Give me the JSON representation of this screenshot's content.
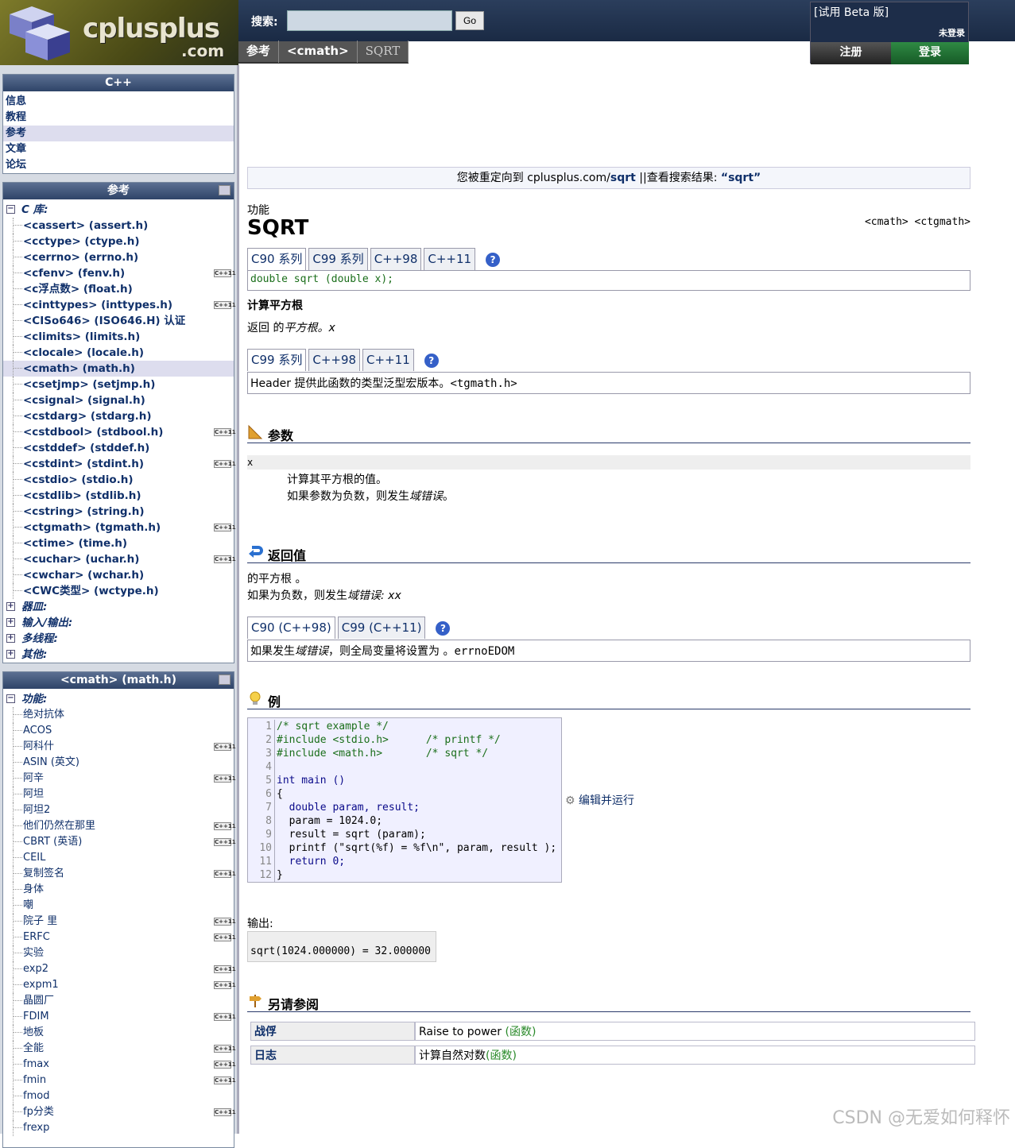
{
  "header": {
    "logo_main": "cplusplus",
    "logo_sub": ".com",
    "search_label": "搜索:",
    "search_value": "",
    "go_label": "Go",
    "breadcrumb": [
      "参考",
      "<cmath>",
      "SQRT"
    ],
    "beta": "[试用 Beta 版]",
    "not_logged": "未登录",
    "register": "注册",
    "login": "登录"
  },
  "sidebar": {
    "cpp_title": "C++",
    "cpp_items": [
      "信息",
      "教程",
      "参考",
      "文章",
      "论坛"
    ],
    "ref_title": "参考",
    "ref_items": [
      {
        "label": "C 库:",
        "cat": true,
        "sign": "⊟"
      },
      {
        "label": "<cassert>  (assert.h)"
      },
      {
        "label": "<cctype>  (ctype.h)"
      },
      {
        "label": "<cerrno>  (errno.h)"
      },
      {
        "label": "<cfenv>  (fenv.h)",
        "badge": "C++11"
      },
      {
        "label": "<c浮点数>  (float.h)"
      },
      {
        "label": "<cinttypes>  (inttypes.h)",
        "badge": "C++11"
      },
      {
        "label": "<CISo646>  (ISO646.H)  认证"
      },
      {
        "label": "<climits>  (limits.h)"
      },
      {
        "label": "<clocale>  (locale.h)"
      },
      {
        "label": "<cmath>  (math.h)",
        "sel": true
      },
      {
        "label": "<csetjmp>  (setjmp.h)"
      },
      {
        "label": "<csignal>  (signal.h)"
      },
      {
        "label": "<cstdarg>  (stdarg.h)"
      },
      {
        "label": "<cstdbool>  (stdbool.h)",
        "badge": "C++11"
      },
      {
        "label": "<cstddef>  (stddef.h)"
      },
      {
        "label": "<cstdint>  (stdint.h)",
        "badge": "C++11"
      },
      {
        "label": "<cstdio>  (stdio.h)"
      },
      {
        "label": "<cstdlib>  (stdlib.h)"
      },
      {
        "label": "<cstring>  (string.h)"
      },
      {
        "label": "<ctgmath>  (tgmath.h)",
        "badge": "C++11"
      },
      {
        "label": "<ctime>  (time.h)"
      },
      {
        "label": "<cuchar>  (uchar.h)",
        "badge": "C++11"
      },
      {
        "label": "<cwchar>  (wchar.h)"
      },
      {
        "label": "<CWC类型>  (wctype.h)"
      },
      {
        "label": "器皿:",
        "cat": true,
        "sign": "⊞"
      },
      {
        "label": "输入/输出:",
        "cat": true,
        "sign": "⊞"
      },
      {
        "label": "多线程:",
        "cat": true,
        "sign": "⊞"
      },
      {
        "label": "其他:",
        "cat": true,
        "sign": "⊞"
      }
    ],
    "math_title": "<cmath>  (math.h)",
    "math_cat": "功能:",
    "math_items": [
      {
        "label": "绝对抗体"
      },
      {
        "label": "ACOS"
      },
      {
        "label": "阿科什",
        "badge": "C++11"
      },
      {
        "label": "ASIN  (英文)"
      },
      {
        "label": "阿辛",
        "badge": "C++11"
      },
      {
        "label": "阿坦"
      },
      {
        "label": "阿坦2"
      },
      {
        "label": "他们仍然在那里",
        "badge": "C++11"
      },
      {
        "label": "CBRT  (英语)",
        "badge": "C++11"
      },
      {
        "label": "CEIL"
      },
      {
        "label": "复制签名",
        "badge": "C++11"
      },
      {
        "label": "身体"
      },
      {
        "label": "嘲"
      },
      {
        "label": "院子 里",
        "badge": "C++11"
      },
      {
        "label": "ERFC",
        "badge": "C++11"
      },
      {
        "label": "实验"
      },
      {
        "label": "exp2",
        "badge": "C++11"
      },
      {
        "label": "expm1",
        "badge": "C++11"
      },
      {
        "label": "晶圆厂"
      },
      {
        "label": "FDIM",
        "badge": "C++11"
      },
      {
        "label": "地板"
      },
      {
        "label": "全能",
        "badge": "C++11"
      },
      {
        "label": "fmax",
        "badge": "C++11"
      },
      {
        "label": "fmin",
        "badge": "C++11"
      },
      {
        "label": "fmod"
      },
      {
        "label": "fp分类",
        "badge": "C++11"
      },
      {
        "label": "frexp"
      }
    ],
    "badge_text": "C++11"
  },
  "main": {
    "redirect_pre": "您被重定向到 cplusplus.com/",
    "redirect_link": "sqrt",
    "redirect_mid": "||查看搜索结果:",
    "redirect_query": "“sqrt”",
    "kind": "功能",
    "title": "SQRT",
    "headers": "<cmath> <ctgmath>",
    "tabs1": [
      "C90 系列",
      "C99 系列",
      "C++98",
      "C++11"
    ],
    "proto": "double sqrt (double x);",
    "brief": "计算平方根",
    "desc_pre": "返回 的",
    "desc_em": "平方根",
    "desc_post": "。x",
    "tabs2": [
      "C99 系列",
      "C++98",
      "C++11"
    ],
    "note2_pre": "Header 提供此函数的类型泛型宏版本。",
    "note2_code": "<tgmath.h>",
    "params_title": "参数",
    "param_name": "x",
    "param_desc1": "计算其平方根的值。",
    "param_desc2_pre": "如果参数为负数，则发生",
    "param_desc2_em": "域错误",
    "param_desc2_post": "。",
    "ret_title": "返回值",
    "ret1": "的平方根 。",
    "ret2_pre": "如果为负数，则发生",
    "ret2_em": "域错误",
    "ret2_post": ": xx",
    "tabs3": [
      "C90  (C++98)",
      "C99  (C++11)"
    ],
    "ret_note_pre": "如果发生",
    "ret_note_em": "域错误",
    "ret_note_mid": "，则全局变量将设置为 。",
    "ret_note_code": "errnoEDOM",
    "example_title": "例",
    "code_lines": [
      "/* sqrt example */",
      "#include <stdio.h>      /* printf */",
      "#include <math.h>       /* sqrt */",
      "",
      "int main ()",
      "{",
      "  double param, result;",
      "  param = 1024.0;",
      "  result = sqrt (param);",
      "  printf (\"sqrt(%f) = %f\\n\", param, result );",
      "  return 0;",
      "}"
    ],
    "edit_run": "编辑并运行",
    "output_label": "输出:",
    "output": "sqrt(1024.000000) = 32.000000",
    "see_title": "另请参阅",
    "see_also": [
      {
        "name": "战俘",
        "desc": "Raise to power ",
        "kind": "(函数)"
      },
      {
        "name": "日志",
        "desc": "计算自然对数",
        "kind": "(函数)"
      }
    ]
  },
  "watermark": "CSDN @无爱如何释怀"
}
